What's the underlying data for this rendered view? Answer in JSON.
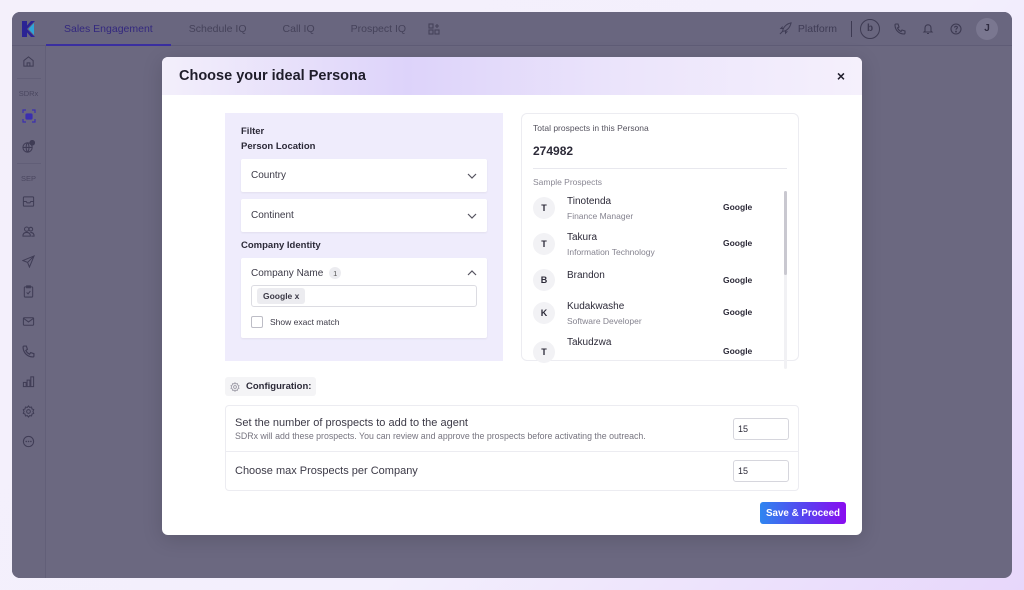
{
  "topbar": {
    "tabs": [
      {
        "label": "Sales Engagement",
        "active": true
      },
      {
        "label": "Schedule IQ",
        "active": false
      },
      {
        "label": "Call IQ",
        "active": false
      },
      {
        "label": "Prospect IQ",
        "active": false
      }
    ],
    "platform_label": "Platform",
    "b_button_label": "b",
    "avatar_initial": "J",
    "accent_color": "#3a2fa0"
  },
  "sidebar": {
    "sections": {
      "sdrx_label": "SDRx",
      "sep_label": "SEP"
    },
    "items": [
      {
        "icon": "home-icon"
      },
      {
        "icon": "agent-icon",
        "active": true
      },
      {
        "icon": "globe-icon"
      },
      {
        "icon": "inbox-icon"
      },
      {
        "icon": "users-icon"
      },
      {
        "icon": "send-icon"
      },
      {
        "icon": "clipboard-check-icon"
      },
      {
        "icon": "mail-icon"
      },
      {
        "icon": "phone-icon"
      },
      {
        "icon": "chart-icon"
      },
      {
        "icon": "gear-icon"
      },
      {
        "icon": "more-icon"
      }
    ]
  },
  "modal": {
    "title": "Choose your ideal Persona",
    "close_label": "×",
    "filter": {
      "title": "Filter",
      "person_location_label": "Person Location",
      "country_label": "Country",
      "continent_label": "Continent",
      "company_identity_label": "Company Identity",
      "company_name_label": "Company Name",
      "company_name_count": "1",
      "company_tag": "Google x",
      "exact_match_label": "Show exact match",
      "exact_match_checked": false
    },
    "prospects": {
      "total_label": "Total prospects in this Persona",
      "total_value": "274982",
      "sample_label": "Sample Prospects",
      "items": [
        {
          "initial": "T",
          "name": "Tinotenda",
          "role": "Finance Manager",
          "company": "Google"
        },
        {
          "initial": "T",
          "name": "Takura",
          "role": "Information Technology",
          "company": "Google"
        },
        {
          "initial": "B",
          "name": "Brandon",
          "role": "",
          "company": "Google"
        },
        {
          "initial": "K",
          "name": "Kudakwashe",
          "role": "Software Developer",
          "company": "Google"
        },
        {
          "initial": "T",
          "name": "Takudzwa",
          "role": "",
          "company": "Google"
        }
      ]
    },
    "configuration": {
      "label": "Configuration:",
      "rows": [
        {
          "title": "Set the number of prospects to add to the agent",
          "subtitle": "SDRx will add these prospects. You can review and approve the prospects before activating the outreach.",
          "value": "15"
        },
        {
          "title": "Choose max Prospects per Company",
          "subtitle": "",
          "value": "15"
        }
      ]
    },
    "save_label": "Save & Proceed"
  }
}
